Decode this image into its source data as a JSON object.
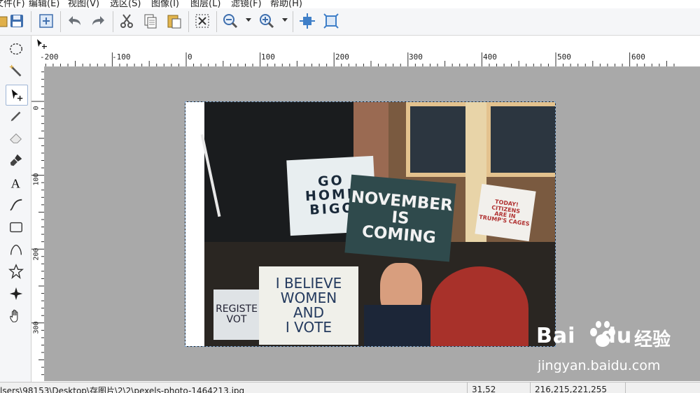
{
  "menu": [
    "文件(F)",
    "编辑(E)",
    "视图(V)",
    "选区(S)",
    "图像(I)",
    "图层(L)",
    "滤镜(F)",
    "帮助(H)"
  ],
  "toolbar": {
    "icons": [
      "save-icon",
      "new-layer-icon",
      "undo-icon",
      "redo-icon",
      "cut-icon",
      "copy-icon",
      "paste-icon",
      "deselect-icon",
      "zoom-out-icon",
      "zoom-in-icon",
      "fit-window-icon",
      "actual-size-icon"
    ]
  },
  "tools": [
    "ellipse-select",
    "magic-wand",
    "move",
    "pencil",
    "eraser",
    "brush",
    "text",
    "curve",
    "rectangle",
    "rounded-shape",
    "star",
    "sparkle",
    "hand"
  ],
  "ruler": {
    "h_labels": [
      "-200",
      "-100",
      "0",
      "100",
      "200",
      "300",
      "400",
      "500",
      "600"
    ],
    "v_labels": [
      "0",
      "100",
      "200",
      "300"
    ]
  },
  "photo_signs": {
    "go_home": "GO\nHOME\nBIGO",
    "november": "NOVEMBER\nIS\nCOMING",
    "believe": "I BELIEVE\nWOMEN\nAND\nI VOTE",
    "register": "REGISTE\nVOT",
    "today": "TODAY!\nCITIZENS\nARE IN\nTRUMP'S CAGES"
  },
  "watermark": {
    "brand": "Bai",
    "brand2": "du",
    "cn": "经验",
    "url": "jingyan.baidu.com"
  },
  "status": {
    "path": "lsers\\98153\\Desktop\\存图片\\2\\2\\pexels-photo-1464213.jpg",
    "coord": "31,52",
    "rgb": "216,215,221,255"
  }
}
